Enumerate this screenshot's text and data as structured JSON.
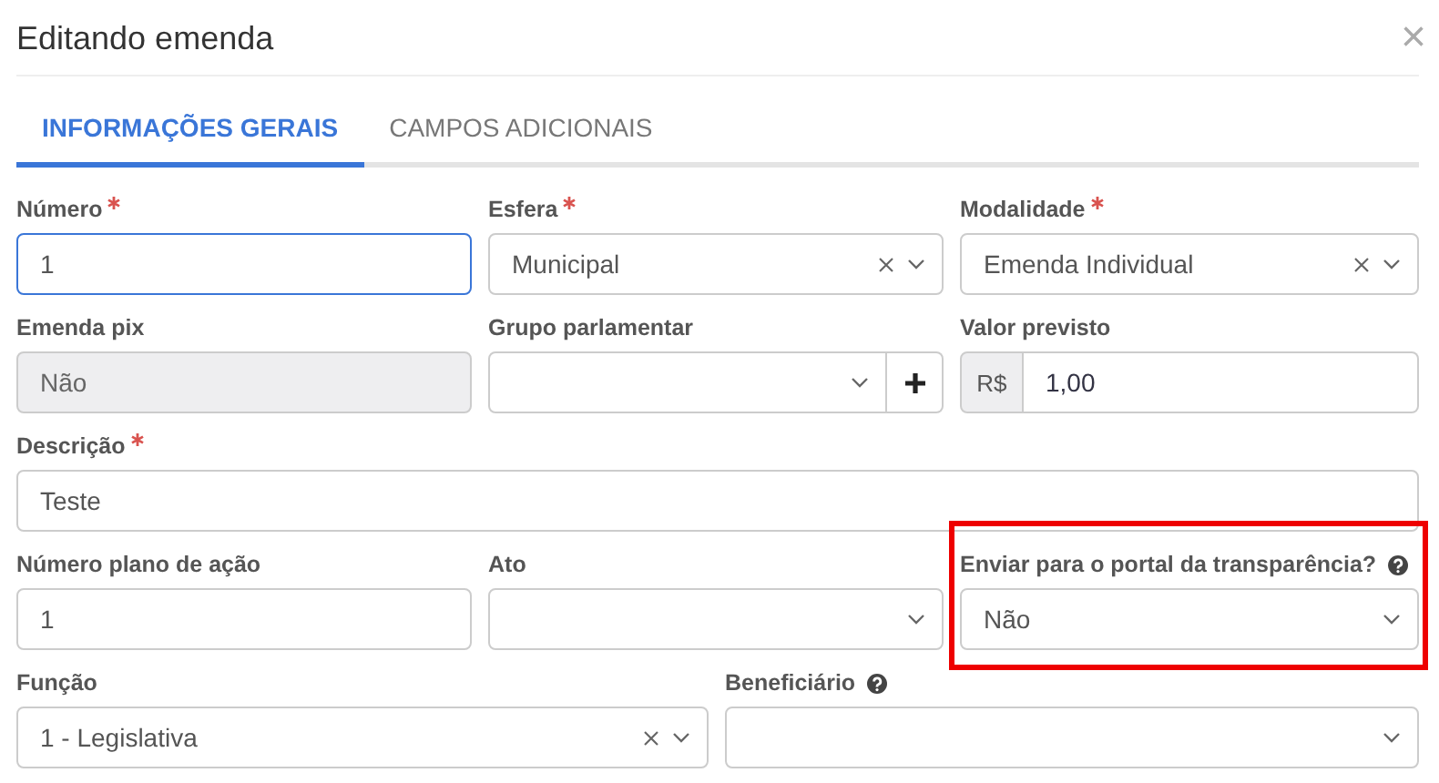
{
  "window": {
    "title": "Editando emenda",
    "close": "×"
  },
  "tabs": [
    {
      "label": "INFORMAÇÕES GERAIS",
      "selected": true
    },
    {
      "label": "CAMPOS ADICIONAIS",
      "selected": false
    }
  ],
  "rows": [
    {
      "fields": [
        {
          "label": "Número",
          "required": true,
          "kind": "text",
          "value": "1",
          "focused": true
        },
        {
          "label": "Esfera",
          "required": true,
          "kind": "select",
          "value": "Municipal",
          "clearable": true
        },
        {
          "label": "Modalidade",
          "required": true,
          "kind": "select",
          "value": "Emenda Individual",
          "clearable": true
        }
      ]
    },
    {
      "fields": [
        {
          "label": "Emenda pix",
          "kind": "text",
          "value": "Não",
          "disabled": true
        },
        {
          "label": "Grupo parlamentar",
          "kind": "select",
          "add_button": true
        },
        {
          "label": "Valor previsto",
          "kind": "money",
          "prefix": "R$",
          "value": "1,00"
        }
      ]
    },
    {
      "fields": [
        {
          "label": "Descrição",
          "required": true,
          "kind": "text",
          "value": "Teste"
        }
      ]
    },
    {
      "fields": [
        {
          "label": "Número plano de ação",
          "kind": "text",
          "value": "1"
        },
        {
          "label": "Ato",
          "kind": "select"
        },
        {
          "label": "Enviar para o portal da transparência?",
          "help": true,
          "kind": "select",
          "value": "Não",
          "highlighted": true
        }
      ]
    },
    {
      "fields": [
        {
          "label": "Função",
          "kind": "select",
          "value": "1 - Legislativa",
          "clearable": true
        },
        {
          "label": "Beneficiário",
          "help": true,
          "kind": "select"
        }
      ]
    }
  ]
}
